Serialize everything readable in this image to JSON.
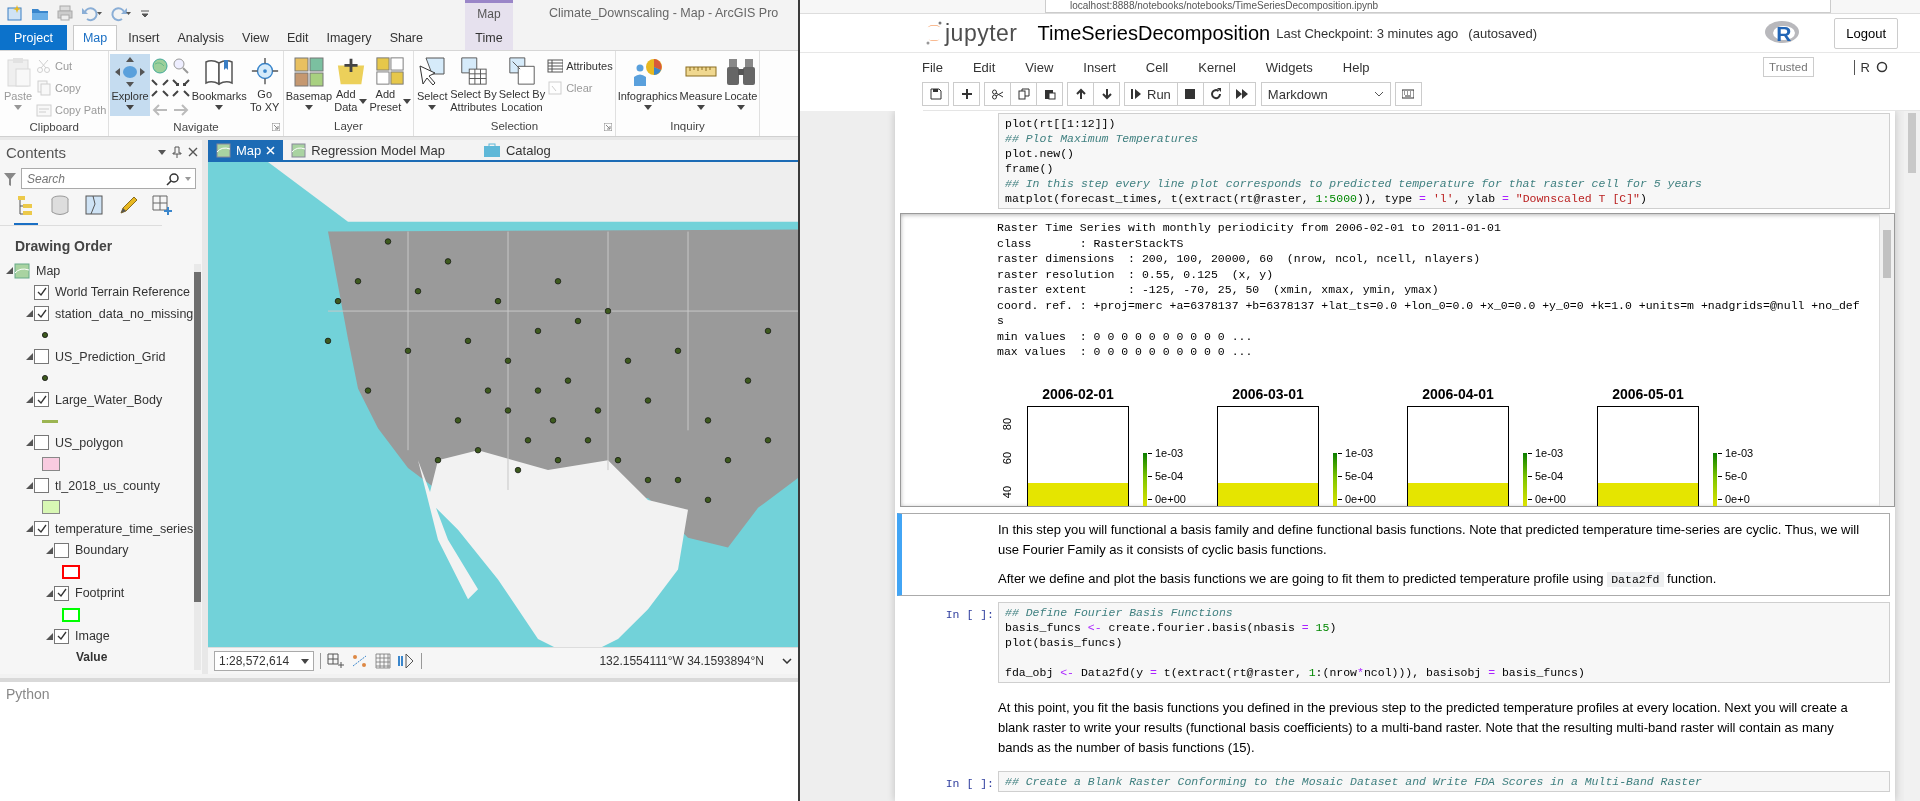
{
  "arcgis": {
    "title": "Climate_Downscaling - Map - ArcGIS Pro",
    "contextual_group": "Map",
    "tabs": [
      {
        "label": "Project",
        "kind": "backstage",
        "selected": false
      },
      {
        "label": "Map",
        "kind": "core",
        "selected": true
      },
      {
        "label": "Insert",
        "kind": "core",
        "selected": false
      },
      {
        "label": "Analysis",
        "kind": "core",
        "selected": false
      },
      {
        "label": "View",
        "kind": "core",
        "selected": false
      },
      {
        "label": "Edit",
        "kind": "core",
        "selected": false
      },
      {
        "label": "Imagery",
        "kind": "core",
        "selected": false
      },
      {
        "label": "Share",
        "kind": "core",
        "selected": false
      },
      {
        "label": "Time",
        "kind": "contextual",
        "selected": false
      }
    ],
    "ribbon_groups": [
      {
        "name": "Clipboard",
        "launcher": false,
        "commands": [
          {
            "label": "Paste",
            "kind": "large",
            "dropdown": true,
            "dropdown_inline": false,
            "disabled": true,
            "selected": false
          },
          {
            "label": "Cut",
            "kind": "small",
            "disabled": true
          },
          {
            "label": "Copy",
            "kind": "small",
            "disabled": true
          },
          {
            "label": "Copy Path",
            "kind": "small",
            "disabled": true
          }
        ]
      },
      {
        "name": "Navigate",
        "launcher": true,
        "commands": [
          {
            "label": "Explore",
            "kind": "large",
            "dropdown": true,
            "dropdown_inline": false,
            "disabled": false,
            "selected": true
          },
          {
            "kind": "nav-grid",
            "disabled": false
          },
          {
            "label": "Bookmarks",
            "kind": "large",
            "dropdown": true,
            "dropdown_inline": false,
            "disabled": false,
            "selected": false
          },
          {
            "label": "Go\nTo XY",
            "kind": "large",
            "dropdown": false,
            "disabled": false,
            "selected": false
          }
        ]
      },
      {
        "name": "Layer",
        "launcher": false,
        "commands": [
          {
            "label": "Basemap",
            "kind": "large",
            "dropdown": true,
            "dropdown_inline": false,
            "disabled": false,
            "selected": false
          },
          {
            "label": "Add\nData",
            "kind": "large",
            "dropdown": true,
            "dropdown_inline": true,
            "disabled": false,
            "selected": false
          },
          {
            "label": "Add\nPreset",
            "kind": "large",
            "dropdown": true,
            "dropdown_inline": true,
            "disabled": false,
            "selected": false
          }
        ]
      },
      {
        "name": "Selection",
        "launcher": true,
        "commands": [
          {
            "label": "Select",
            "kind": "large",
            "dropdown": true,
            "dropdown_inline": false,
            "disabled": false,
            "selected": false
          },
          {
            "label": "Select By\nAttributes",
            "kind": "large",
            "dropdown": false,
            "disabled": false,
            "selected": false
          },
          {
            "label": "Select By\nLocation",
            "kind": "large",
            "dropdown": false,
            "disabled": false,
            "selected": false
          },
          {
            "label": "Attributes",
            "kind": "small",
            "disabled": false
          },
          {
            "label": "Clear",
            "kind": "small",
            "disabled": true
          }
        ]
      },
      {
        "name": "Inquiry",
        "launcher": false,
        "commands": [
          {
            "label": "Infographics",
            "kind": "large",
            "dropdown": true,
            "dropdown_inline": false,
            "disabled": false,
            "selected": false
          },
          {
            "label": "Measure",
            "kind": "large",
            "dropdown": true,
            "dropdown_inline": false,
            "disabled": false,
            "selected": false
          },
          {
            "label": "Locate",
            "kind": "large",
            "dropdown": true,
            "dropdown_inline": false,
            "disabled": false,
            "selected": false
          }
        ]
      }
    ],
    "contents": {
      "title": "Contents",
      "search_placeholder": "Search",
      "views": [
        {
          "selected": true
        },
        {
          "selected": false
        },
        {
          "selected": false
        },
        {
          "selected": false
        },
        {
          "selected": false
        }
      ],
      "heading": "Drawing Order",
      "tree": [
        {
          "label": "Map",
          "kind": "map",
          "expanded": true,
          "children": [
            {
              "label": "World Terrain Reference",
              "kind": "layer",
              "checked": true
            },
            {
              "label": "station_data_no_missing",
              "kind": "layer",
              "checked": true,
              "expanded": true,
              "symbol": {
                "kind": "point",
                "color": "#3d5a1e"
              }
            },
            {
              "label": "US_Prediction_Grid",
              "kind": "layer",
              "checked": false,
              "expanded": true,
              "symbol": {
                "kind": "point",
                "color": "#3d5a1e"
              }
            },
            {
              "label": "Large_Water_Body",
              "kind": "layer",
              "checked": true,
              "expanded": true,
              "symbol": {
                "kind": "line",
                "color": "#9cb552"
              }
            },
            {
              "label": "US_polygon",
              "kind": "layer",
              "checked": false,
              "expanded": true,
              "symbol": {
                "kind": "fill",
                "color": "#f9cbe0"
              }
            },
            {
              "label": "tl_2018_us_county",
              "kind": "layer",
              "checked": false,
              "expanded": true,
              "symbol": {
                "kind": "fill",
                "color": "#d8f7b4"
              }
            },
            {
              "label": "temperature_time_series",
              "kind": "layer",
              "checked": true,
              "expanded": true,
              "children": [
                {
                  "label": "Boundary",
                  "kind": "layer",
                  "checked": false,
                  "expanded": true,
                  "symbol": {
                    "kind": "outline",
                    "color": "#ff0000"
                  }
                },
                {
                  "label": "Footprint",
                  "kind": "layer",
                  "checked": true,
                  "expanded": true,
                  "symbol": {
                    "kind": "outline",
                    "color": "#00ff00"
                  }
                },
                {
                  "label": "Image",
                  "kind": "layer",
                  "checked": true,
                  "expanded": true,
                  "legend_heading": "Value"
                }
              ]
            }
          ]
        }
      ]
    },
    "map_tabs": [
      {
        "label": "Map",
        "kind": "map",
        "selected": true,
        "closable": true
      },
      {
        "label": "Regression Model Map",
        "kind": "map",
        "selected": false,
        "closable": false
      },
      {
        "label": "Catalog",
        "kind": "catalog",
        "selected": false,
        "closable": false
      }
    ],
    "map_status": {
      "scale": "1:28,572,614",
      "coordinates": "132.1554111°W 34.1593894°N"
    },
    "python_pane": {
      "title": "Python"
    }
  },
  "browser": {
    "url": "localhost:8888/notebooks/notebooks/TimeSeriesDecomposition.ipynb"
  },
  "jupyter": {
    "logo": "jupyter",
    "notebook_name": "TimeSeriesDecomposition",
    "checkpoint": "Last Checkpoint: 3 minutes ago",
    "autosave": "(autosaved)",
    "kernel_logo": "R",
    "logout": "Logout",
    "menu": [
      "File",
      "Edit",
      "View",
      "Insert",
      "Cell",
      "Kernel",
      "Widgets",
      "Help"
    ],
    "trusted": "Trusted",
    "kernel_name": "R",
    "kernel_busy": false,
    "toolbar": {
      "run": "Run",
      "cell_type": "Markdown"
    },
    "cells": [
      {
        "kind": "code",
        "lines": [
          {
            "kind": "code",
            "tokens": [
              {
                "kind": "plain",
                "text": "plot(rt[[1:12]])"
              }
            ]
          },
          {
            "kind": "comment",
            "text": "## Plot Maximum Temperatures"
          },
          {
            "kind": "code",
            "tokens": [
              {
                "kind": "plain",
                "text": "plot.new()"
              }
            ]
          },
          {
            "kind": "code",
            "tokens": [
              {
                "kind": "plain",
                "text": "frame()"
              }
            ]
          },
          {
            "kind": "comment",
            "text": "## In this step every line plot corresponds to predicted temperature for that raster cell for 5 years"
          },
          {
            "kind": "code",
            "tokens": [
              {
                "kind": "plain",
                "text": "matplot(forecast_times, t(extract(rt@raster, "
              },
              {
                "kind": "number",
                "text": "1:5000"
              },
              {
                "kind": "plain",
                "text": ")), type "
              },
              {
                "kind": "operator",
                "text": "= "
              },
              {
                "kind": "string",
                "text": "'l'"
              },
              {
                "kind": "plain",
                "text": ", ylab "
              },
              {
                "kind": "operator",
                "text": "= "
              },
              {
                "kind": "string",
                "text": "\"Downscaled T [C]\""
              },
              {
                "kind": "plain",
                "text": ")"
              }
            ]
          }
        ]
      },
      {
        "kind": "output",
        "lines": [
          "Raster Time Series with monthly periodicity from 2006-02-01 to 2011-01-01",
          "class       : RasterStackTS",
          "raster dimensions  : 200, 100, 20000, 60  (nrow, ncol, ncell, nlayers)",
          "raster resolution  : 0.55, 0.125  (x, y)",
          "raster extent      : -125, -70, 25, 50  (xmin, xmax, ymin, ymax)",
          "coord. ref. : +proj=merc +a=6378137 +b=6378137 +lat_ts=0.0 +lon_0=0.0 +x_0=0.0 +y_0=0 +k=1.0 +units=m +nadgrids=@null +no_def",
          "s",
          "min values  : 0 0 0 0 0 0 0 0 0 0 ...",
          "max values  : 0 0 0 0 0 0 0 0 0 0 ..."
        ],
        "plot_panels": [
          {
            "title": "2006-02-01",
            "y_ticks": [
              "80",
              "60",
              "40"
            ],
            "legend_ticks": [
              "1e-03",
              "5e-04",
              "0e+00"
            ]
          },
          {
            "title": "2006-03-01",
            "legend_ticks": [
              "1e-03",
              "5e-04",
              "0e+00"
            ]
          },
          {
            "title": "2006-04-01",
            "legend_ticks": [
              "1e-03",
              "5e-04",
              "0e+00"
            ]
          },
          {
            "title": "2006-05-01",
            "legend_ticks": [
              "1e-03",
              "5e-0",
              "0e+0"
            ]
          }
        ]
      },
      {
        "kind": "markdown",
        "selected": true,
        "paragraphs": [
          {
            "text": "In this step you will functional a basis family and define functional basis functions. Note that predicted temperature time-series are cyclic. Thus, we will use Fourier Family as it consists of cyclic basis functions."
          },
          {
            "text": "After we define and plot the basis functions we are going to fit them to predicted temperature profile using ",
            "code": "Data2fd",
            "tail": " function."
          }
        ]
      },
      {
        "kind": "code",
        "prompt": "In [ ]:",
        "lines": [
          {
            "kind": "comment",
            "text": "## Define Fourier Basis Functions"
          },
          {
            "kind": "code",
            "tokens": [
              {
                "kind": "plain",
                "text": "basis_funcs "
              },
              {
                "kind": "operator",
                "text": "<-"
              },
              {
                "kind": "plain",
                "text": " create.fourier.basis(nbasis "
              },
              {
                "kind": "operator",
                "text": "= "
              },
              {
                "kind": "number",
                "text": "15"
              },
              {
                "kind": "plain",
                "text": ")"
              }
            ]
          },
          {
            "kind": "code",
            "tokens": [
              {
                "kind": "plain",
                "text": "plot(basis_funcs)"
              }
            ]
          },
          {
            "kind": "blank"
          },
          {
            "kind": "code",
            "tokens": [
              {
                "kind": "plain",
                "text": "fda_obj "
              },
              {
                "kind": "operator",
                "text": "<-"
              },
              {
                "kind": "plain",
                "text": " Data2fd(y "
              },
              {
                "kind": "operator",
                "text": "="
              },
              {
                "kind": "plain",
                "text": " t(extract(rt@raster, "
              },
              {
                "kind": "number",
                "text": "1"
              },
              {
                "kind": "plain",
                "text": ":(nrow"
              },
              {
                "kind": "operator",
                "text": "*"
              },
              {
                "kind": "plain",
                "text": "ncol))), basisobj "
              },
              {
                "kind": "operator",
                "text": "="
              },
              {
                "kind": "plain",
                "text": " basis_funcs)"
              }
            ]
          }
        ]
      },
      {
        "kind": "markdown",
        "selected": false,
        "paragraphs": [
          {
            "text": "At this point, you fit the basis functions you defined in the previous step to the predicted temperature profiles at every location. Next you will create a blank raster to write your results (functional basis coefficients) to a multi-band raster. Note that the resulting multi-band raster will contain as many bands as the number of basis functions (15)."
          }
        ]
      },
      {
        "kind": "code",
        "prompt": "In [ ]:",
        "lines": [
          {
            "kind": "comment",
            "text": "## Create a Blank Raster Conforming to the Mosaic Dataset and Write FDA Scores in a Multi-Band Raster"
          }
        ]
      }
    ]
  }
}
